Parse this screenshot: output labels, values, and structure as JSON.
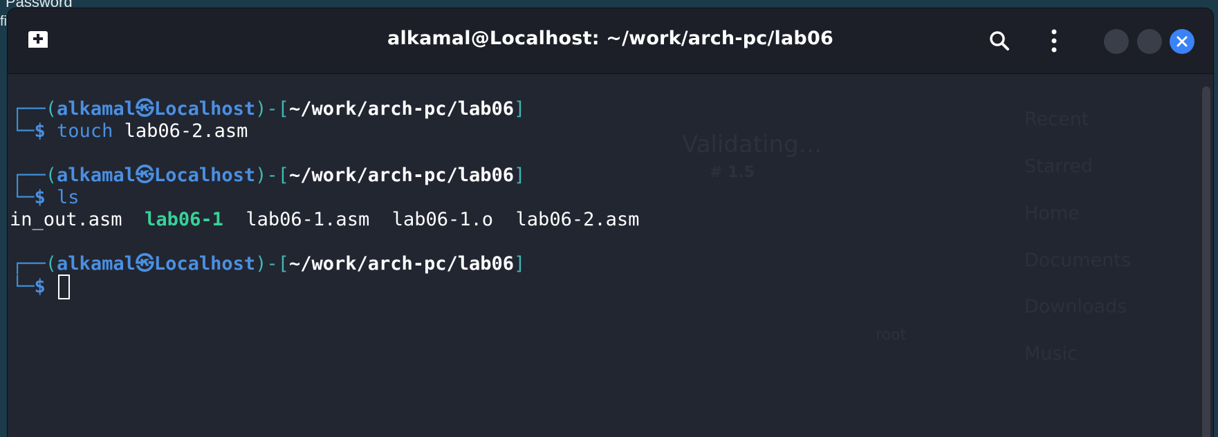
{
  "desktop": {
    "background_text": "Password",
    "background_text_2": "fi"
  },
  "window": {
    "title": "alkamal@Localhost: ~/work/arch-pc/lab06",
    "buttons": {
      "new_tab_icon": "new-tab-icon",
      "search_icon": "search-icon",
      "menu_icon": "kebab-menu-icon",
      "minimize_icon": "minimize-icon",
      "maximize_icon": "maximize-icon",
      "close_icon": "close-icon"
    }
  },
  "terminal": {
    "prompt": {
      "user": "alkamal",
      "separator_glyph": "㉿",
      "host": "Localhost",
      "path": "~/work/arch-pc/lab06",
      "dollar": "$"
    },
    "entries": [
      {
        "command": "touch",
        "args": "lab06-2.asm"
      },
      {
        "command": "ls",
        "args": ""
      }
    ],
    "ls_output": [
      {
        "name": "in_out.asm",
        "type": "file"
      },
      {
        "name": "lab06-1",
        "type": "executable"
      },
      {
        "name": "lab06-1.asm",
        "type": "file"
      },
      {
        "name": "lab06-1.o",
        "type": "file"
      },
      {
        "name": "lab06-2.asm",
        "type": "file"
      }
    ]
  },
  "background_window": {
    "status": "Validating…",
    "version": "# 1.5",
    "label_root": "root",
    "sidebar": [
      "Recent",
      "Starred",
      "Home",
      "Documents",
      "Downloads",
      "Music"
    ]
  },
  "colors": {
    "accent": "#4a90e2",
    "teal": "#3fb8b3",
    "executable": "#36d399",
    "terminal_bg": "#222631",
    "titlebar_bg": "#1c1f27",
    "close_button": "#3b82f6"
  }
}
